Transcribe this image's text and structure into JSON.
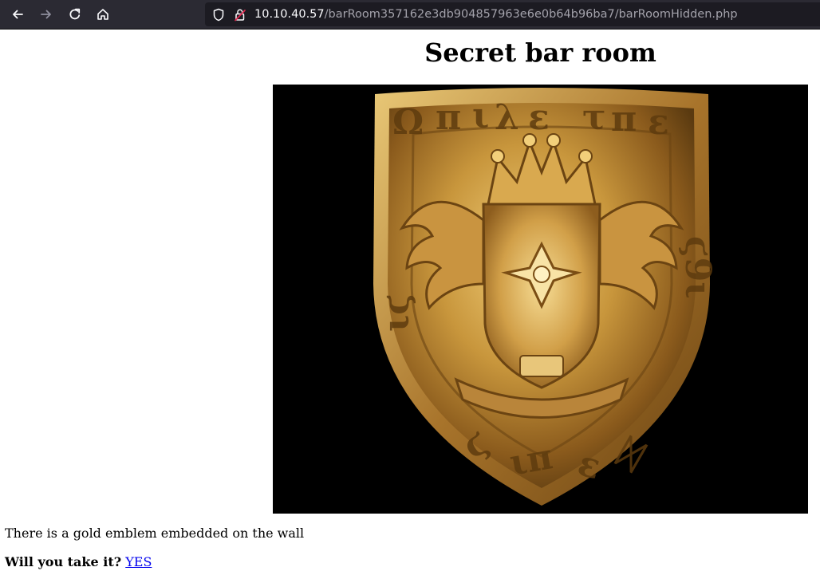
{
  "browser": {
    "url_host": "10.10.40.57",
    "url_path": "/barRoom357162e3db904857963e6e0b64b96ba7/barRoomHidden.php",
    "icons": [
      "back-arrow-icon",
      "forward-arrow-icon",
      "reload-icon",
      "home-icon",
      "shield-icon",
      "lock-icon"
    ]
  },
  "page": {
    "title": "Secret bar room",
    "image": {
      "subject": "gold-emblem",
      "background_color": "#000000"
    },
    "description": "There is a gold emblem embedded on the wall",
    "question": "Will you take it?",
    "answer_link": "YES"
  },
  "colors": {
    "toolbar_bg": "#2b2a33",
    "urlbar_bg": "#1c1b22",
    "link": "#0000ee",
    "gold": "#c8963c"
  }
}
